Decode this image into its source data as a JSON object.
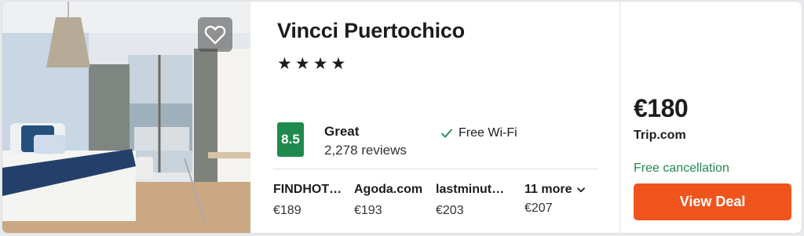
{
  "hotel": {
    "name": "Vincci Puertochico",
    "stars_text": "★★★★",
    "star_count": 4
  },
  "photo": {
    "alt": "hotel room photo",
    "favorite_icon": "heart-outline-icon"
  },
  "rating": {
    "score": "8.5",
    "label": "Great",
    "reviews": "2,278 reviews",
    "color": "#1f8a4d"
  },
  "amenity": {
    "icon": "checkmark-icon",
    "label": "Free Wi-Fi"
  },
  "offers": [
    {
      "site": "FINDHOT…",
      "price": "€189"
    },
    {
      "site": "Agoda.com",
      "price": "€193"
    },
    {
      "site": "lastminut…",
      "price": "€203"
    }
  ],
  "more": {
    "label": "11 more",
    "price": "€207",
    "icon": "chevron-down-icon"
  },
  "deal": {
    "price": "€180",
    "provider": "Trip.com",
    "cancellation": "Free cancellation",
    "button": "View Deal",
    "button_color": "#f0541d"
  }
}
